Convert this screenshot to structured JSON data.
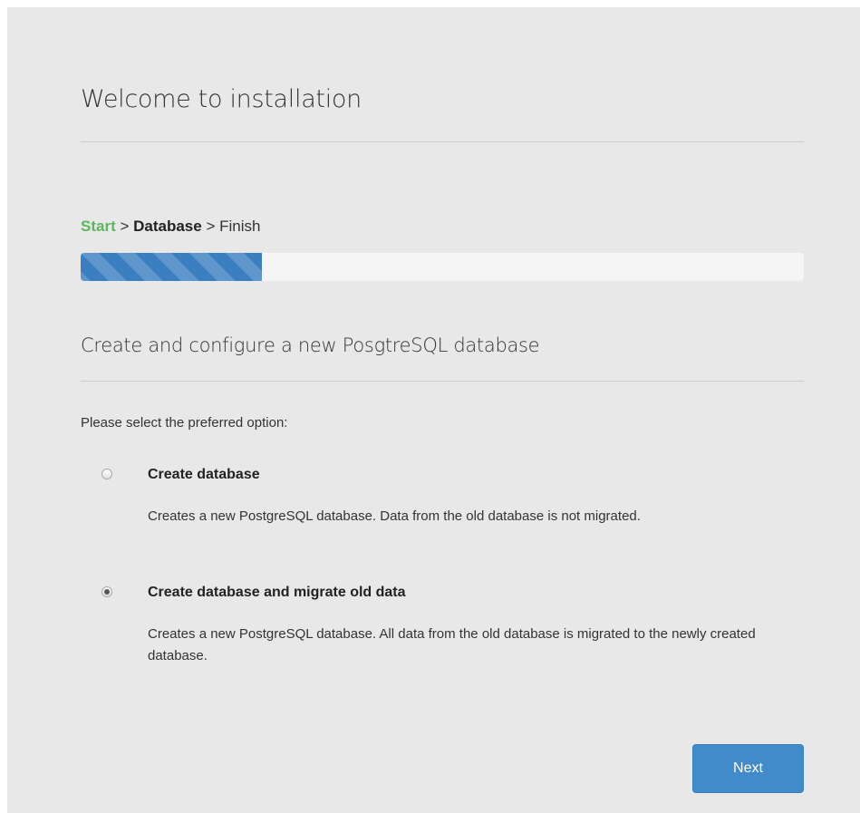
{
  "header": {
    "title": "Welcome to installation"
  },
  "steps": {
    "start": "Start",
    "sep1": " > ",
    "database": "Database",
    "sep2": " > ",
    "finish": "Finish"
  },
  "progress": {
    "fraction": 0.25,
    "color": "#3c7fc0"
  },
  "section": {
    "title": "Create and configure a new PosgtreSQL database",
    "prompt": "Please select the preferred option:"
  },
  "options": [
    {
      "label": "Create database",
      "description": "Creates a new PostgreSQL database. Data from the old database is not migrated.",
      "selected": false
    },
    {
      "label": "Create database and migrate old data",
      "description": "Creates a new PostgreSQL database. All data from the old database is migrated to the newly created database.",
      "selected": true
    }
  ],
  "actions": {
    "next_label": "Next",
    "primary_color": "#428bca"
  },
  "colors": {
    "panel_background": "#e8e8e8",
    "step_done": "#5cb85c"
  }
}
